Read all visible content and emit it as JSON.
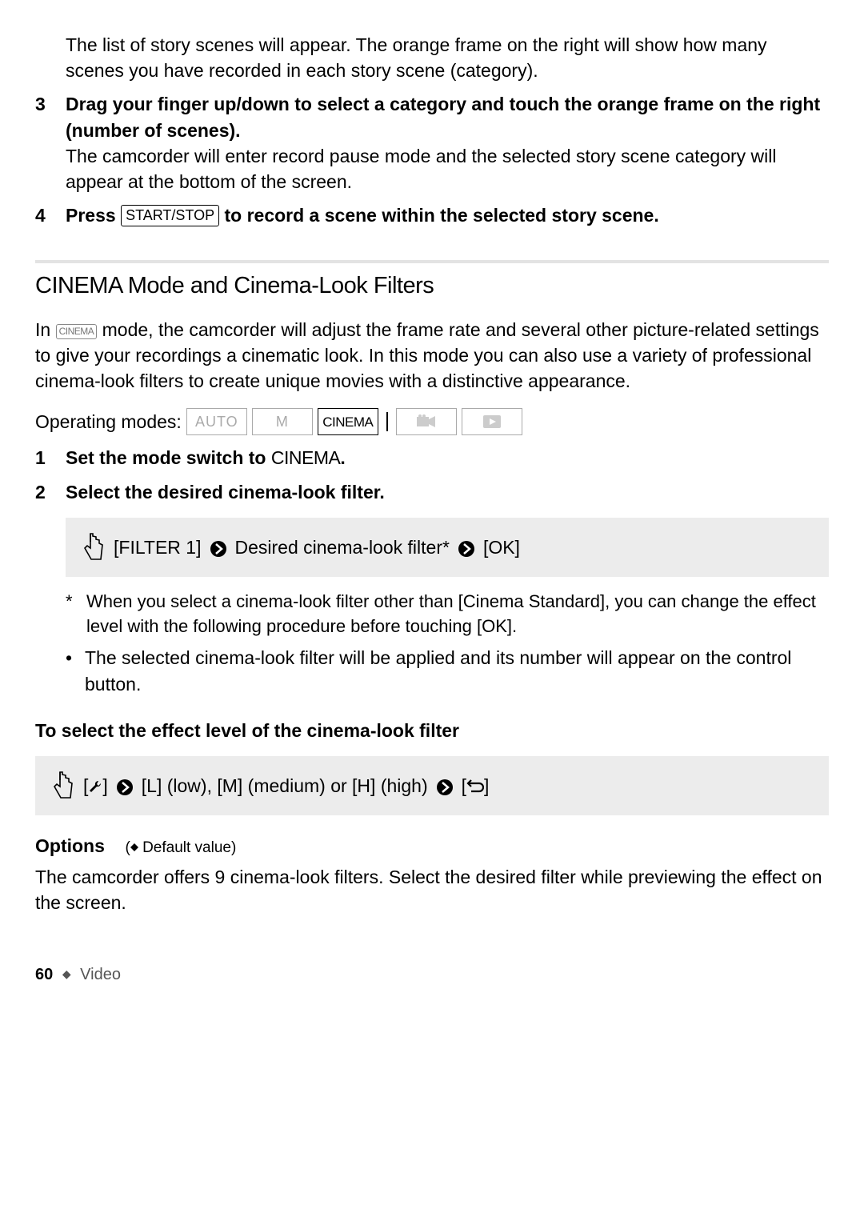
{
  "intro_paragraph": "The list of story scenes will appear. The orange frame on the right will show how many scenes you have recorded in each story scene (category).",
  "step3": {
    "num": "3",
    "title": "Drag your finger up/down to select a category and touch the orange frame on the right (number of scenes).",
    "body": "The camcorder will enter record pause mode and the selected story scene category will appear at the bottom of the screen."
  },
  "step4": {
    "num": "4",
    "press_word": "Press",
    "button_label": "START/STOP",
    "after": " to record a scene within the selected story scene."
  },
  "section_title": "CINEMA Mode and Cinema-Look Filters",
  "cinema_paragraph_before": "In ",
  "cinema_badge": "CINEMA",
  "cinema_paragraph_after": " mode, the camcorder will adjust the frame rate and several other picture-related settings to give your recordings a cinematic look. In this mode you can also use a variety of professional cinema-look filters to create unique movies with a distinctive appearance.",
  "operating_modes_label": "Operating modes:",
  "modes": {
    "auto": "AUTO",
    "m": "M",
    "cinema": "CINEMA"
  },
  "cstep1": {
    "num": "1",
    "before": "Set the mode switch to ",
    "word": "CINEMA",
    "after": "."
  },
  "cstep2": {
    "num": "2",
    "title": "Select the desired cinema-look filter."
  },
  "touch1": {
    "filter": "[FILTER 1]",
    "mid": "Desired cinema-look filter*",
    "ok": "[OK]"
  },
  "footnote": "When you select a cinema-look filter other than [Cinema Standard], you can change the effect level with the following procedure before touching [OK].",
  "bullet": "The selected cinema-look filter will be applied and its number will appear on the control button.",
  "subhead": "To select the effect level of the cinema-look filter",
  "touch2": {
    "levels": "[L] (low), [M] (medium) or [H] (high)"
  },
  "options_word": "Options",
  "options_note": "Default value)",
  "options_body": "The camcorder offers 9 cinema-look filters. Select the desired filter while previewing the effect on the screen.",
  "footer": {
    "page": "60",
    "section": "Video"
  }
}
